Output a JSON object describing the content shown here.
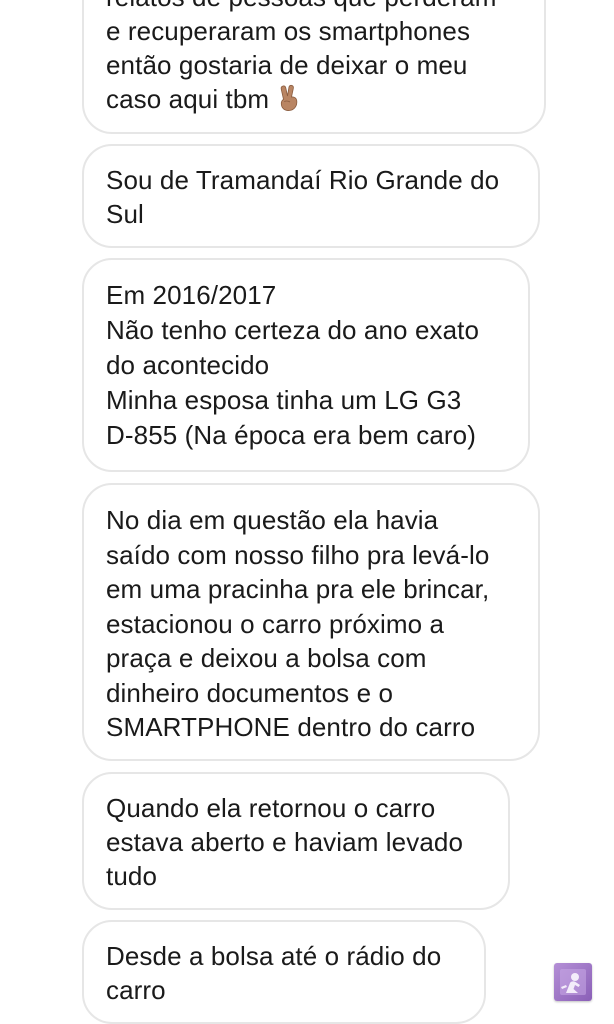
{
  "messages": [
    {
      "lines": [
        "relatos de pessoas que perderam",
        "e recuperaram os smartphones",
        "então gostaria de deixar o meu",
        "caso aqui tbm"
      ],
      "emoji": "victory-hand-medium-skin-tone"
    },
    {
      "lines": [
        "Sou de Tramandaí Rio Grande do",
        "Sul"
      ]
    },
    {
      "lines": [
        "Em 2016/2017",
        "Não tenho certeza do ano exato",
        "do acontecido",
        "Minha esposa tinha um LG G3",
        "D-855 (Na época era bem caro)"
      ]
    },
    {
      "lines": [
        "No dia em questão ela havia",
        "saído com nosso filho pra levá-lo",
        "em uma pracinha pra ele brincar,",
        "estacionou o carro próximo a",
        "praça e deixou a bolsa com",
        "dinheiro documentos e o",
        "SMARTPHONE dentro do carro"
      ]
    },
    {
      "lines": [
        "Quando ela retornou o carro",
        "estava aberto e haviam levado",
        "tudo"
      ]
    },
    {
      "lines": [
        "Desde a bolsa até o rádio do",
        "carro"
      ]
    }
  ],
  "theme": {
    "bubble_border": "#e6e6e6",
    "text_color": "#1a1a1a",
    "background": "#ffffff",
    "badge_color": "#9b6cc6"
  },
  "icons": {
    "corner_badge": "user-profile-icon"
  }
}
